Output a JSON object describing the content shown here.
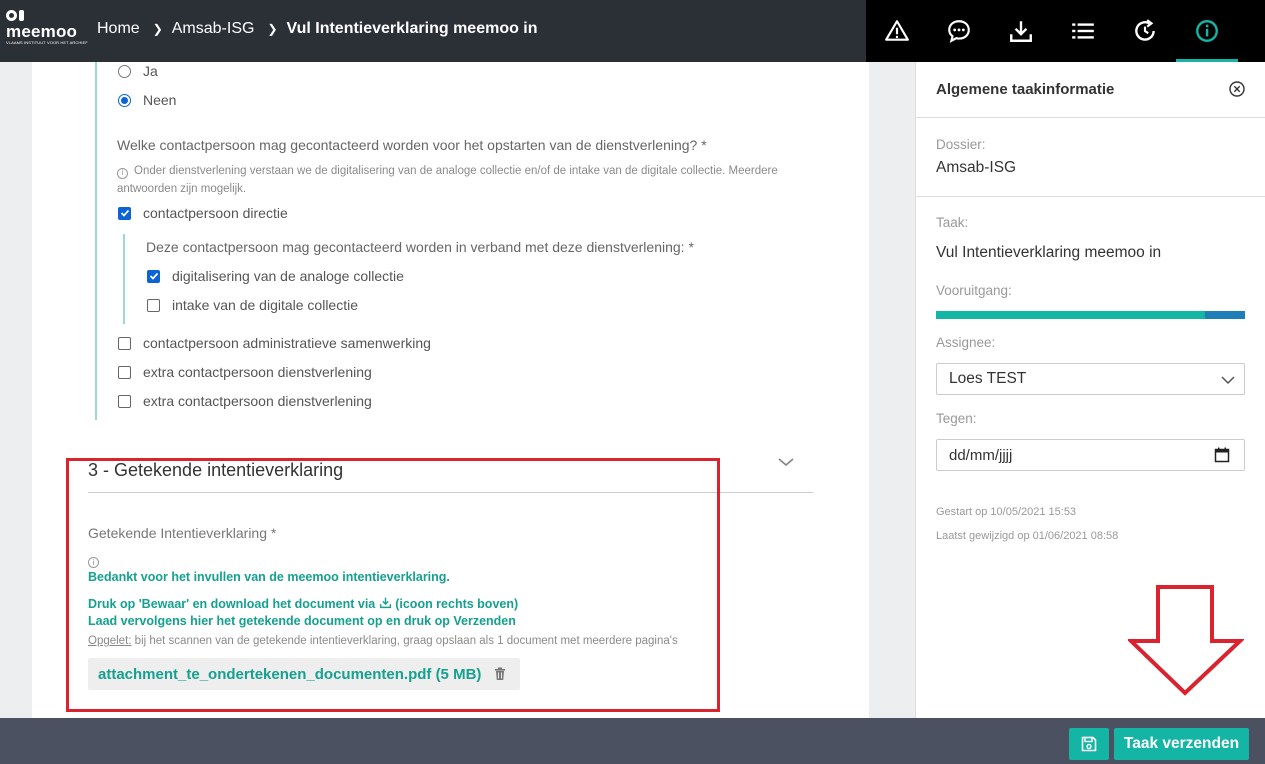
{
  "header": {
    "logo_text": "meemoo",
    "logo_sub": "VLAAMS INSTITUUT VOOR HET ARCHIEF",
    "breadcrumb": [
      "Home",
      "Amsab-ISG",
      "Vul Intentieverklaring meemoo in"
    ]
  },
  "toolbar": {
    "icons": [
      "warning-icon",
      "comment-icon",
      "download-icon",
      "list-icon",
      "history-icon",
      "info-icon"
    ],
    "active": "info-icon"
  },
  "form": {
    "radio_yes": "Ja",
    "radio_no": "Neen",
    "question": "Welke contactpersoon mag gecontacteerd worden voor het opstarten van de dienstverlening? *",
    "hint": "Onder dienstverlening verstaan we de digitalisering van de analoge collectie en/of de intake van de digitale collectie. Meerdere antwoorden zijn mogelijk.",
    "cb_directie": "contactpersoon directie",
    "subquestion": "Deze contactpersoon mag gecontacteerd worden in verband met deze dienstverlening: *",
    "cb_digitalisering": "digitalisering van de analoge collectie",
    "cb_intake": "intake van de digitale collectie",
    "cb_admin": "contactpersoon administratieve samenwerking",
    "cb_extra1": "extra contactpersoon dienstverlening",
    "cb_extra2": "extra contactpersoon dienstverlening"
  },
  "section3": {
    "title": "3 - Getekende intentieverklaring",
    "field_label": "Getekende Intentieverklaring *",
    "info_line1": "Bedankt voor het invullen van de meemoo intentieverklaring.",
    "info_line2a": "Druk op 'Bewaar' en download het document via",
    "info_line2b": "(icoon rechts boven)",
    "info_line3": "Laad vervolgens hier het getekende document op en druk op Verzenden",
    "opgelet_label": "Opgelet:",
    "opgelet_text": " bij het scannen van de getekende intentieverklaring, graag opslaan als 1 document met meerdere pagina's",
    "attachment": "attachment_te_ondertekenen_documenten.pdf (5 MB)"
  },
  "side": {
    "title": "Algemene taakinformatie",
    "dossier_label": "Dossier:",
    "dossier_value": "Amsab-ISG",
    "taak_label": "Taak:",
    "taak_value": "Vul Intentieverklaring meemoo in",
    "progress_label": "Vooruitgang:",
    "progress_fraction": 0.87,
    "assignee_label": "Assignee:",
    "assignee_value": "Loes TEST",
    "tegen_label": "Tegen:",
    "date_placeholder": "dd/mm/jjjj",
    "started": "Gestart op 10/05/2021 15:53",
    "modified": "Laatst gewijzigd op 01/06/2021 08:58"
  },
  "footer": {
    "send_label": "Taak verzenden"
  },
  "colors": {
    "accent": "#14b5a4",
    "header": "#2b2f36",
    "highlight": "#d9232e"
  }
}
